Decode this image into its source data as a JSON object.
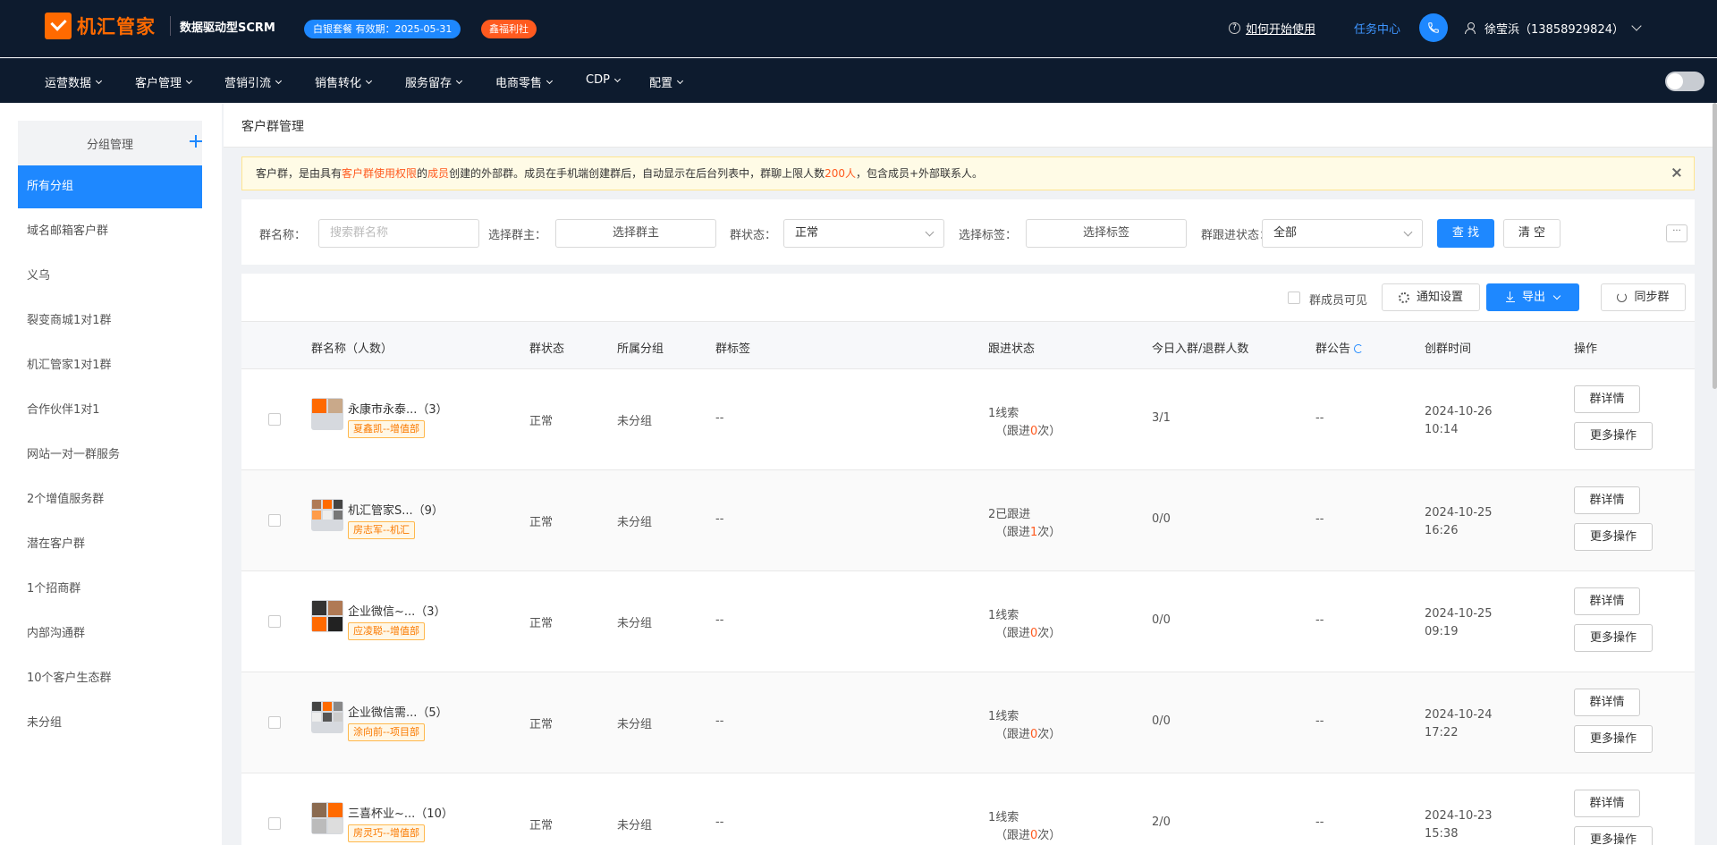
{
  "header": {
    "logo_text": "机汇管家",
    "subtitle": "数据驱动型SCRM",
    "plan_badge": "白银套餐  有效期：2025-05-31",
    "welfare_badge": "鑫福利社",
    "help_link": "如何开始使用",
    "task_center": "任务中心",
    "user_name": "徐莹浜（13858929824）"
  },
  "nav": {
    "items": [
      "运营数据",
      "客户管理",
      "营销引流",
      "销售转化",
      "服务留存",
      "电商零售",
      "CDP",
      "配置"
    ]
  },
  "sidebar": {
    "title": "分组管理",
    "items": [
      "所有分组",
      "域名邮箱客户群",
      "义乌",
      "裂变商城1对1群",
      "机汇管家1对1群",
      "合作伙伴1对1",
      "网站一对一群服务",
      "2个增值服务群",
      "潜在客户群",
      "1个招商群",
      "内部沟通群",
      "10个客户生态群",
      "未分组"
    ]
  },
  "page": {
    "title": "客户群管理"
  },
  "notice": {
    "p1": "客户群，是由具有",
    "link1": "客户群使用权限",
    "p2": "的",
    "link2": "成员",
    "p3": "创建的外部群。成员在手机端创建群后，自动显示在后台列表中，群聊上限人数",
    "limit": "200人",
    "p4": "，包含成员+外部联系人。"
  },
  "filter": {
    "name_label": "群名称：",
    "name_placeholder": "搜索群名称",
    "owner_label": "选择群主：",
    "owner_btn": "选择群主",
    "status_label": "群状态：",
    "status_value": "正常",
    "tag_label": "选择标签：",
    "tag_btn": "选择标签",
    "follow_label": "群跟进状态：",
    "follow_value": "全部",
    "search_btn": "查 找",
    "clear_btn": "清 空",
    "more": "···"
  },
  "toolbar": {
    "member_visible": "群成员可见",
    "notify_settings": "通知设置",
    "export": "导出",
    "sync": "同步群"
  },
  "table": {
    "headers": [
      "群名称（人数）",
      "群状态",
      "所属分组",
      "群标签",
      "跟进状态",
      "今日入群/退群人数",
      "群公告",
      "创群时间",
      "操作"
    ],
    "follow_prefix": "（跟进",
    "follow_suffix": "次）",
    "op_detail": "群详情",
    "op_more": "更多操作",
    "rows": [
      {
        "name": "永康市永泰...",
        "count": "（3）",
        "tag": "夏鑫凯--增值部",
        "status": "正常",
        "group": "未分组",
        "labels": "--",
        "follow": "1线索",
        "follow_times": "0",
        "inout": "3/1",
        "notice": "--",
        "date": "2024-10-26",
        "time": "10:14"
      },
      {
        "name": "机汇管家S...",
        "count": "（9）",
        "tag": "房志军--机汇",
        "status": "正常",
        "group": "未分组",
        "labels": "--",
        "follow": "2已跟进",
        "follow_times": "1",
        "inout": "0/0",
        "notice": "--",
        "date": "2024-10-25",
        "time": "16:26"
      },
      {
        "name": "企业微信~...",
        "count": "（3）",
        "tag": "应凌聪--增值部",
        "status": "正常",
        "group": "未分组",
        "labels": "--",
        "follow": "1线索",
        "follow_times": "0",
        "inout": "0/0",
        "notice": "--",
        "date": "2024-10-25",
        "time": "09:19"
      },
      {
        "name": "企业微信需...",
        "count": "（5）",
        "tag": "涂向前--项目部",
        "status": "正常",
        "group": "未分组",
        "labels": "--",
        "follow": "1线索",
        "follow_times": "0",
        "inout": "0/0",
        "notice": "--",
        "date": "2024-10-24",
        "time": "17:22"
      },
      {
        "name": "三喜杯业~...",
        "count": "（10）",
        "tag": "房灵巧--增值部",
        "status": "正常",
        "group": "未分组",
        "labels": "--",
        "follow": "1线索",
        "follow_times": "0",
        "inout": "2/0",
        "notice": "--",
        "date": "2024-10-23",
        "time": "15:38"
      }
    ]
  }
}
